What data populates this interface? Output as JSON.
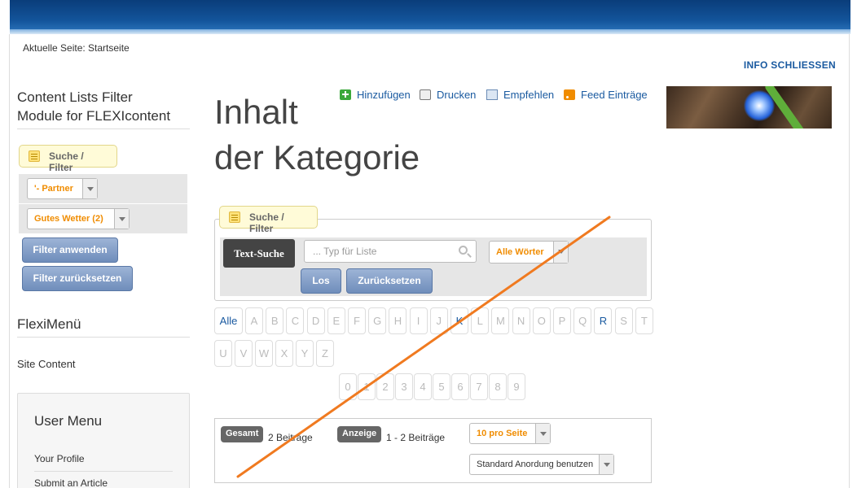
{
  "breadcrumb": "Aktuelle Seite: Startseite",
  "info_close": "INFO SCHLIESSEN",
  "sidebar": {
    "filter_module": {
      "title_line1": "Content Lists Filter",
      "title_line2": "Module for FLEXIcontent",
      "tab_label": "Suche / Filter",
      "select1": "'- Partner",
      "select2": "Gutes Wetter (2)",
      "apply_button": "Filter anwenden",
      "reset_button": "Filter zurücksetzen"
    },
    "flexi_menu": {
      "title": "FlexiMenü",
      "item": "Site Content"
    },
    "user_menu": {
      "title": "User Menu",
      "items": [
        "Your Profile",
        "Submit an Article"
      ]
    }
  },
  "main": {
    "title_line1": "Inhalt",
    "title_line2": "der Kategorie",
    "toolbar": {
      "add": "Hinzufügen",
      "print": "Drucken",
      "recommend": "Empfehlen",
      "feed": "Feed Einträge"
    },
    "filter": {
      "tab_label": "Suche / Filter",
      "text_search_label": "Text-Suche",
      "search_placeholder": "... Typ für Liste",
      "words_select": "Alle Wörter",
      "go_button": "Los",
      "reset_button": "Zurücksetzen"
    },
    "alpha": {
      "all": "Alle",
      "row1": [
        "A",
        "B",
        "C",
        "D",
        "E",
        "F",
        "G",
        "H",
        "I",
        "J",
        "K",
        "L",
        "M",
        "N",
        "O",
        "P",
        "Q",
        "R",
        "S",
        "T"
      ],
      "row2": [
        "U",
        "V",
        "W",
        "X",
        "Y",
        "Z"
      ],
      "digits": [
        "0",
        "1",
        "2",
        "3",
        "4",
        "5",
        "6",
        "7",
        "8",
        "9"
      ],
      "active": [
        "K",
        "R"
      ]
    },
    "pagination": {
      "total_tag": "Gesamt",
      "total_text": "2 Beiträge",
      "display_tag": "Anzeige",
      "display_text": "1 - 2 Beiträge",
      "per_page_select": "10 pro Seite",
      "order_select": "Standard Anordung benutzen"
    }
  },
  "colors": {
    "link": "#1a5aa0",
    "accent_orange": "#f08c00",
    "annotation_line": "#f07a20"
  }
}
